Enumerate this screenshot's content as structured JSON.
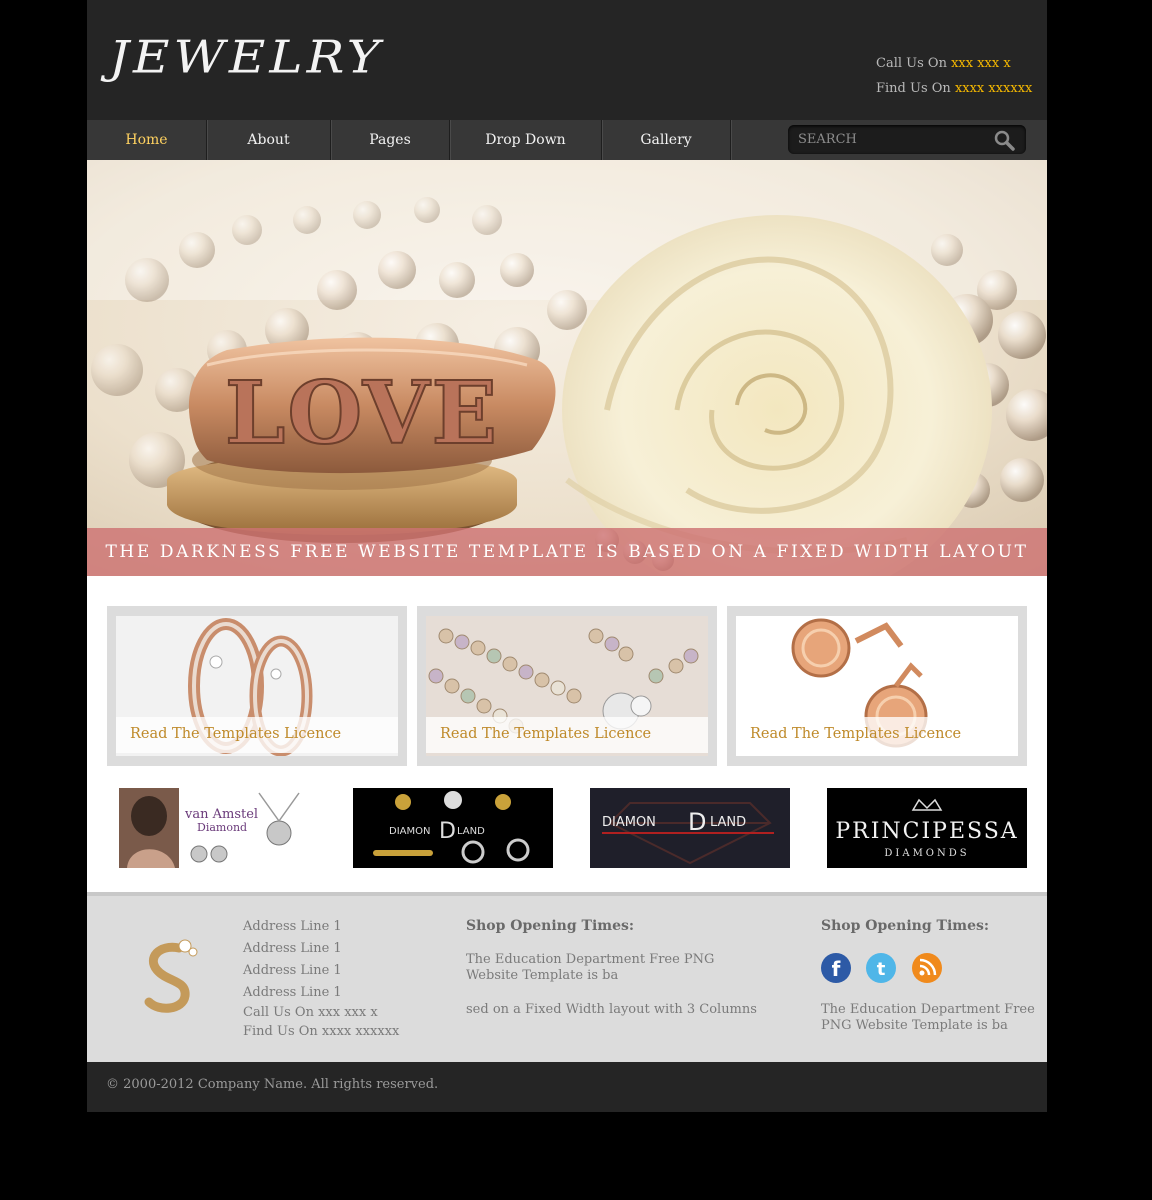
{
  "header": {
    "logo_text": "JEWELRY",
    "call_label": "Call Us On",
    "call_value": "xxx xxx x",
    "find_label": "Find Us On",
    "find_value": "xxxx xxxxxx"
  },
  "nav": {
    "items": [
      "Home",
      "About",
      "Pages",
      "Drop Down",
      "Gallery"
    ],
    "active": "Home",
    "search_placeholder": "SEARCH"
  },
  "banner": {
    "ring_engraving": "LOVE",
    "caption": "THE DARKNESS FREE WEBSITE TEMPLATE IS BASED ON A FIXED WIDTH LAYOUT"
  },
  "features": [
    {
      "label": "Read The Templates Licence"
    },
    {
      "label": "Read The Templates Licence"
    },
    {
      "label": "Read The Templates Licence"
    }
  ],
  "brands": {
    "vanamstel_1": "van Amstel",
    "vanamstel_2": "Diamond",
    "diamondland_a": "DIAMON",
    "diamondland_b": "D",
    "diamondland_c": "LAND",
    "principessa_1": "PRINCIPESSA",
    "principessa_2": "DIAMONDS"
  },
  "footer": {
    "address_lines": [
      "Address Line 1",
      "Address Line 1",
      "Address Line 1",
      "Address Line 1"
    ],
    "call": "Call Us On xxx xxx x",
    "find": "Find Us On xxxx xxxxxx",
    "col2_heading": "Shop Opening Times:",
    "col2_p1_line1": "The Education Department Free PNG",
    "col2_p1_line2": "Website Template is ba",
    "col2_p2": "sed on a Fixed Width layout with 3 Columns",
    "col3_heading": "Shop Opening Times:",
    "col3_line1": "The Education Department Free",
    "col3_line2": "PNG Website Template is ba",
    "social": [
      "facebook-icon",
      "twitter-icon",
      "rss-icon"
    ],
    "social_colors": {
      "facebook": "#2d5aa6",
      "twitter": "#4fb6e8",
      "rss": "#f08a1c"
    }
  },
  "copyright": "© 2000-2012 Company Name. All rights reserved.",
  "colors": {
    "accent": "#f5b800",
    "nav_active": "#ffd260",
    "caption_bar": "#cd7373",
    "link_gold": "#bf8a2a"
  }
}
